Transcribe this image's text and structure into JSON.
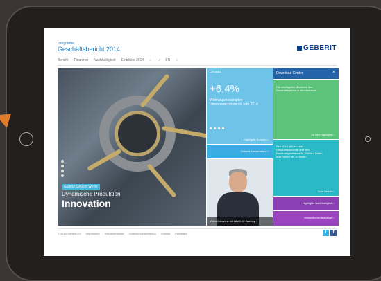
{
  "header": {
    "subtitle": "Integrierter",
    "title": "Geschäftsbericht 2014",
    "logo": "GEBERIT"
  },
  "nav": {
    "items": [
      "Bericht",
      "Finanzen",
      "Nachhaltigkeit",
      "Einblicke 2014"
    ],
    "lang": "EN"
  },
  "hero": {
    "tag": "Galerie Geberit Werte",
    "line1": "Dynamische Produktion",
    "line2": "Innovation"
  },
  "umsatz": {
    "label": "Umsatz",
    "value": "+6,4%",
    "desc": "Währungsbereinigtes Umsatzwachstum im Jahr 2014",
    "cta": "Highlights Konzern"
  },
  "konzern": {
    "cta": "Geberit Konzernstory"
  },
  "person": {
    "caption": "Video-Interview mit Albert M. Baehny"
  },
  "download": {
    "label": "Download Center",
    "close": "×"
  },
  "green": {
    "text": "Die wichtigsten Momente des Geschäftsjahres in der Übersicht",
    "cta": "Zu den Highlights"
  },
  "teal": {
    "text": "Seit 2014 gibt es zwei Geschäftsberichte und den Nachhaltigkeitsbericht, Zahlen, Daten und Fakten bis zu finden",
    "cta": "Zum Bericht"
  },
  "purple1": {
    "cta": "Highlights Nachhaltigkeit"
  },
  "purple2": {
    "cta": "Wesentlichkeitsanalyse"
  },
  "footer": {
    "items": [
      "© 2015 Geberit AG",
      "Impressum",
      "Rechtshinweise",
      "Datenschutzerklärung",
      "Glossar",
      "Feedback"
    ]
  },
  "colors": {
    "brand": "#0b3e8a",
    "accent": "#3aaee0",
    "green": "#5bc47a",
    "purple": "#8a3fb2"
  }
}
